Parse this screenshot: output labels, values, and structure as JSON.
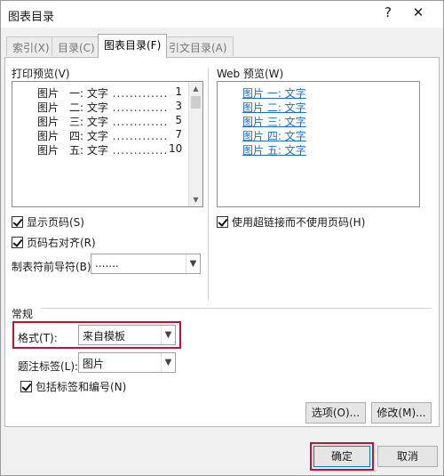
{
  "window": {
    "title": "图表目录",
    "help": "?",
    "close": "✕"
  },
  "tabs": [
    {
      "label": "索引(X)"
    },
    {
      "label": "目录(C)"
    },
    {
      "label": "图表目录(F)"
    },
    {
      "label": "引文目录(A)"
    }
  ],
  "print_preview": {
    "label": "打印预览(V)",
    "entries": [
      {
        "title": "图片　一: 文字",
        "page": "1"
      },
      {
        "title": "图片　二: 文字",
        "page": "3"
      },
      {
        "title": "图片　三: 文字",
        "page": "5"
      },
      {
        "title": "图片　四: 文字",
        "page": "7"
      },
      {
        "title": "图片　五: 文字",
        "page": "10"
      }
    ]
  },
  "web_preview": {
    "label": "Web 预览(W)",
    "entries": [
      "图片 一: 文字",
      "图片 二: 文字",
      "图片 三: 文字",
      "图片 四: 文字",
      "图片 五: 文字"
    ]
  },
  "options": {
    "show_page_numbers": "显示页码(S)",
    "right_align_page_numbers": "页码右对齐(R)",
    "tab_leader_label": "制表符前导符(B):",
    "tab_leader_value": ".......",
    "use_hyperlinks": "使用超链接而不使用页码(H)"
  },
  "general": {
    "section_label": "常规",
    "format_label": "格式(T):",
    "format_value": "来自模板",
    "caption_label": "题注标签(L):",
    "caption_value": "图片",
    "include_label_number": "包括标签和编号(N)"
  },
  "buttons": {
    "options": "选项(O)...",
    "modify": "修改(M)...",
    "ok": "确定",
    "cancel": "取消"
  },
  "colors": {
    "highlight": "#c8102e",
    "link": "#1a6fc4"
  }
}
